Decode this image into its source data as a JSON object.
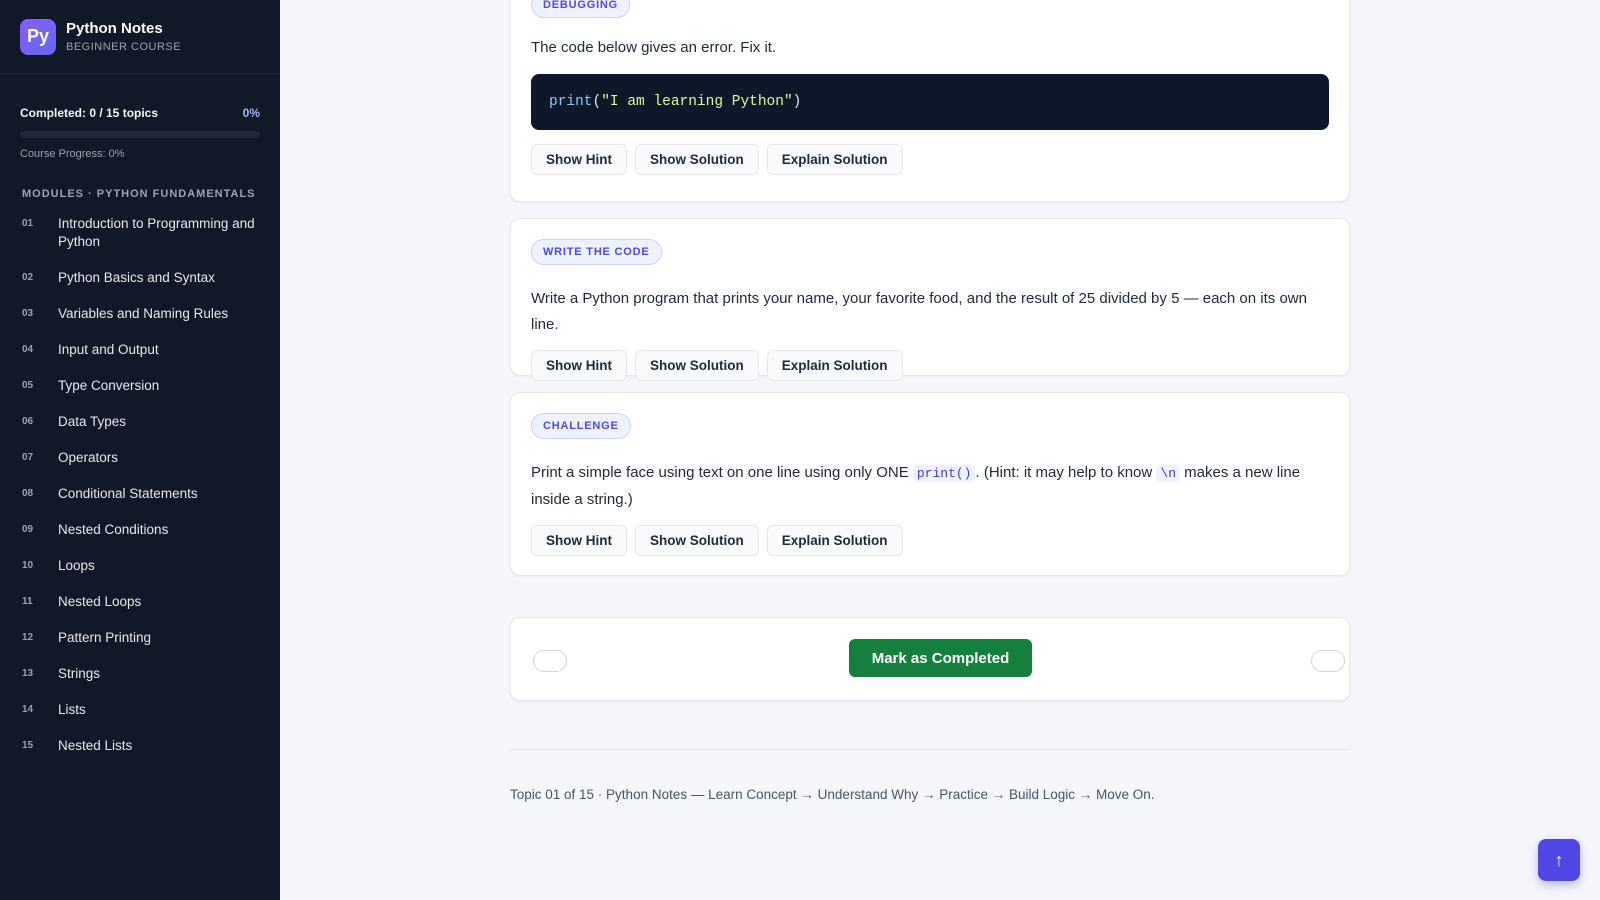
{
  "brand": {
    "logo": "Py",
    "title": "Python Notes",
    "subtitle": "BEGINNER COURSE"
  },
  "progress": {
    "summary": "Completed: 0 / 15 topics",
    "percent_label": "0%",
    "value": 0,
    "caption": "Course Progress: 0%"
  },
  "modules": {
    "heading": "MODULES · PYTHON FUNDAMENTALS",
    "items": [
      {
        "num": "01",
        "title": "Introduction to Programming and Python"
      },
      {
        "num": "02",
        "title": "Python Basics and Syntax"
      },
      {
        "num": "03",
        "title": "Variables and Naming Rules"
      },
      {
        "num": "04",
        "title": "Input and Output"
      },
      {
        "num": "05",
        "title": "Type Conversion"
      },
      {
        "num": "06",
        "title": "Data Types"
      },
      {
        "num": "07",
        "title": "Operators"
      },
      {
        "num": "08",
        "title": "Conditional Statements"
      },
      {
        "num": "09",
        "title": "Nested Conditions"
      },
      {
        "num": "10",
        "title": "Loops"
      },
      {
        "num": "11",
        "title": "Nested Loops"
      },
      {
        "num": "12",
        "title": "Pattern Printing"
      },
      {
        "num": "13",
        "title": "Strings"
      },
      {
        "num": "14",
        "title": "Lists"
      },
      {
        "num": "15",
        "title": "Nested Lists"
      }
    ]
  },
  "buttons": {
    "hint": "Show Hint",
    "solution": "Show Solution",
    "explain": "Explain Solution"
  },
  "exercises": [
    {
      "badge": "DEBUGGING",
      "question": "The code below gives an error. Fix it.",
      "code": {
        "fn": "print",
        "open": "(",
        "string": "\"I am learning Python\"",
        "close": ")"
      }
    },
    {
      "badge": "WRITE THE CODE",
      "question": "Write a Python program that prints your name, your favorite food, and the result of 25 divided by 5 — each on its own line."
    },
    {
      "badge": "CHALLENGE",
      "question_parts": {
        "a": "Print a simple face using text on one line using only ONE ",
        "code1": "print()",
        "b": ". (Hint: it may help to know ",
        "code2": "\\n",
        "c": " makes a new line inside a string.)"
      }
    }
  ],
  "navigation": {
    "complete_label": "Mark as Completed"
  },
  "footer": {
    "text": "Topic 01 of 15 · Python Notes — Learn Concept → Understand Why → Practice → Build Logic → Move On."
  },
  "back_to_top": {
    "label": "↑"
  },
  "colors": {
    "accent": "#4f46e5",
    "sidebar_bg": "#111827",
    "success": "#15803d",
    "code_bg": "#0f172a"
  }
}
